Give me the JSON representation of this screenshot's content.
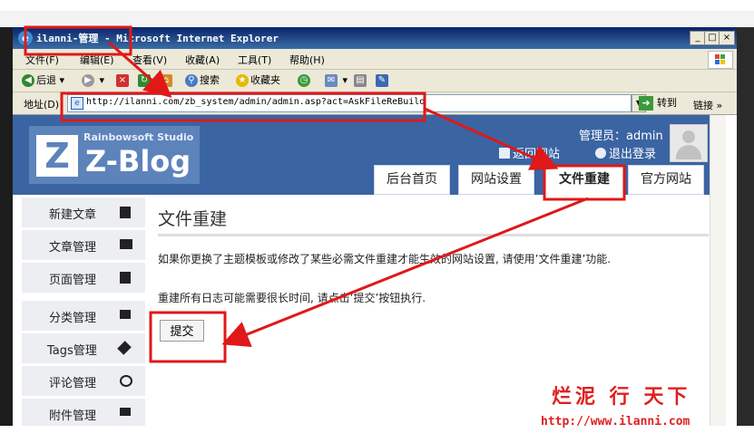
{
  "browser": {
    "window_title": "ilanni-管理 - Microsoft Internet Explorer",
    "menu": [
      "文件(F)",
      "编辑(E)",
      "查看(V)",
      "收藏(A)",
      "工具(T)",
      "帮助(H)"
    ],
    "toolbar": {
      "back_label": "后退",
      "search_label": "搜索",
      "favorites_label": "收藏夹"
    },
    "address_label": "地址(D)",
    "url": "http://ilanni.com/zb_system/admin/admin.asp?act=AskFileReBuild",
    "go_label": "转到",
    "links_label": "链接"
  },
  "header": {
    "studio_text": "Rainbowsoft Studio",
    "logo_text": "Z-Blog",
    "logo_letter": "Z",
    "admin_label": "管理员：admin",
    "back_site_link": "返回网站",
    "logout_link": "退出登录",
    "tabs": [
      {
        "label": "后台首页",
        "active": false
      },
      {
        "label": "网站设置",
        "active": false
      },
      {
        "label": "文件重建",
        "active": true
      },
      {
        "label": "官方网站",
        "active": false
      }
    ]
  },
  "sidebar": {
    "items": [
      {
        "label": "新建文章",
        "icon": "edit-icon"
      },
      {
        "label": "文章管理",
        "icon": "book-icon"
      },
      {
        "label": "页面管理",
        "icon": "page-icon"
      },
      {
        "label": "分类管理",
        "icon": "folder-icon"
      },
      {
        "label": "Tags管理",
        "icon": "tag-icon"
      },
      {
        "label": "评论管理",
        "icon": "comment-icon"
      },
      {
        "label": "附件管理",
        "icon": "attachment-icon"
      }
    ]
  },
  "main": {
    "title": "文件重建",
    "paragraph1": "如果你更换了主题模板或修改了某些必需文件重建才能生效的网站设置, 请使用’文件重建’功能.",
    "paragraph2": "重建所有日志可能需要很长时间, 请点击’提交’按钮执行.",
    "submit_label": "提交"
  },
  "watermark": {
    "text": "烂泥 行 天下",
    "url": "http://www.ilanni.com"
  },
  "colors": {
    "header_bg": "#3b64a2",
    "annotation_red": "#e01818",
    "watermark_red": "#e02020",
    "titlebar": "#0a246a"
  }
}
